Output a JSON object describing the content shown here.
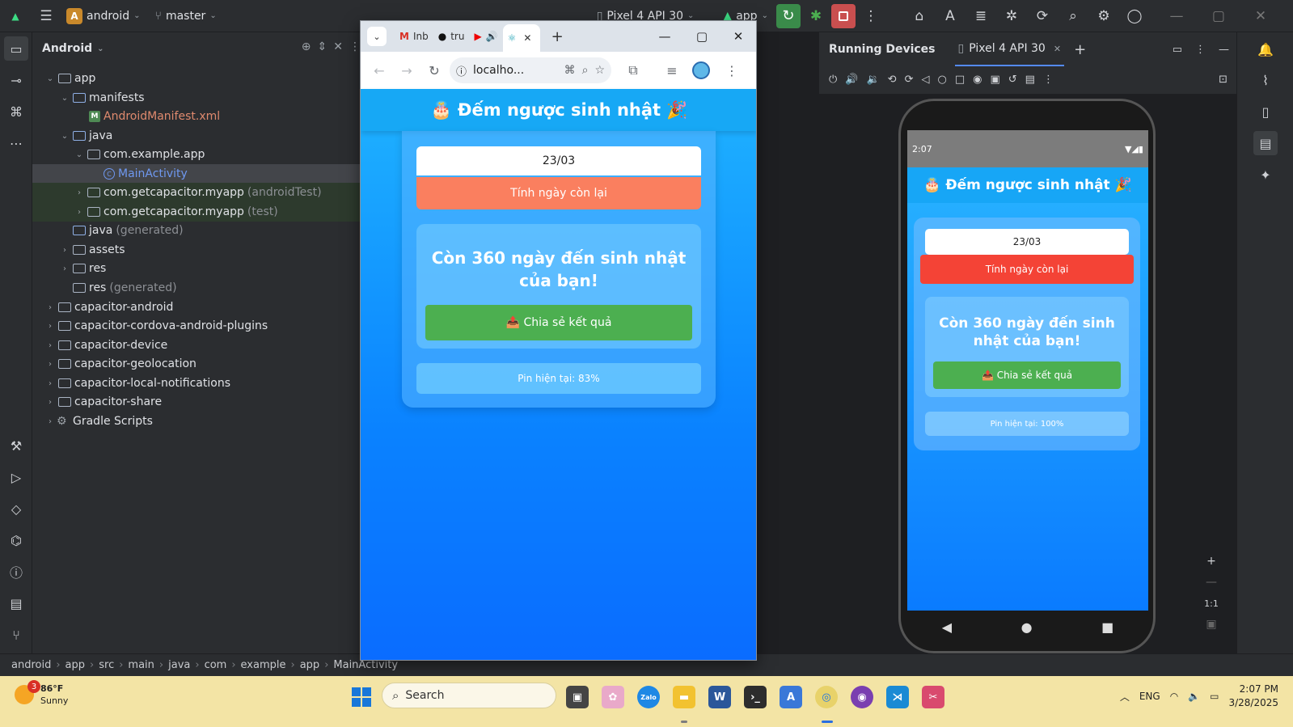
{
  "ide": {
    "project_badge": "A",
    "project_name": "android",
    "branch": "master",
    "device": "Pixel 4 API 30",
    "run_config": "app",
    "panel_title": "Android"
  },
  "tree": [
    {
      "label": "app",
      "muted": ""
    },
    {
      "label": "manifests",
      "muted": ""
    },
    {
      "label": "AndroidManifest.xml",
      "muted": ""
    },
    {
      "label": "java",
      "muted": ""
    },
    {
      "label": "com.example.app",
      "muted": ""
    },
    {
      "label": "MainActivity",
      "muted": ""
    },
    {
      "label": "com.getcapacitor.myapp",
      "muted": "(androidTest)"
    },
    {
      "label": "com.getcapacitor.myapp",
      "muted": "(test)"
    },
    {
      "label": "java",
      "muted": "(generated)"
    },
    {
      "label": "assets",
      "muted": ""
    },
    {
      "label": "res",
      "muted": ""
    },
    {
      "label": "res",
      "muted": "(generated)"
    },
    {
      "label": "capacitor-android",
      "muted": ""
    },
    {
      "label": "capacitor-cordova-android-plugins",
      "muted": ""
    },
    {
      "label": "capacitor-device",
      "muted": ""
    },
    {
      "label": "capacitor-geolocation",
      "muted": ""
    },
    {
      "label": "capacitor-local-notifications",
      "muted": ""
    },
    {
      "label": "capacitor-share",
      "muted": ""
    },
    {
      "label": "Gradle Scripts",
      "muted": ""
    }
  ],
  "devices": {
    "title": "Running Devices",
    "tab": "Pixel 4 API 30",
    "zoom_label": "1:1"
  },
  "phone": {
    "time": "2:07",
    "app_title": "🎂 Đếm ngược sinh nhật 🎉",
    "date_value": "23/03",
    "calc_label": "Tính ngày còn lại",
    "result": "Còn 360 ngày đến sinh nhật của bạn!",
    "share_label": "📤 Chia sẻ kết quả",
    "battery": "Pin hiện tại: 100%"
  },
  "breadcrumb": [
    "android",
    "app",
    "src",
    "main",
    "java",
    "com",
    "example",
    "app",
    "MainActivity"
  ],
  "browser": {
    "tabs": [
      {
        "label": "Inb"
      },
      {
        "label": "tru"
      },
      {
        "label": ""
      }
    ],
    "url": "localho...",
    "page_title": "🎂 Đếm ngược sinh nhật 🎉",
    "date_value": "23/03",
    "calc_label": "Tính ngày còn lại",
    "result": "Còn 360 ngày đến sinh nhật của bạn!",
    "share_label": "📤 Chia sẻ kết quả",
    "battery": "Pin hiện tại: 83%"
  },
  "taskbar": {
    "weather_badge": "3",
    "temperature": "86°F",
    "condition": "Sunny",
    "search_placeholder": "Search",
    "language": "ENG",
    "time": "2:07 PM",
    "date": "3/28/2025",
    "zalo_label": "Zalo"
  },
  "colors": {
    "page_gradient_top": "#1fb3ff",
    "calc_button_browser": "#fa7f5f",
    "calc_button_phone": "#f44336",
    "share_button": "#4caf50"
  }
}
